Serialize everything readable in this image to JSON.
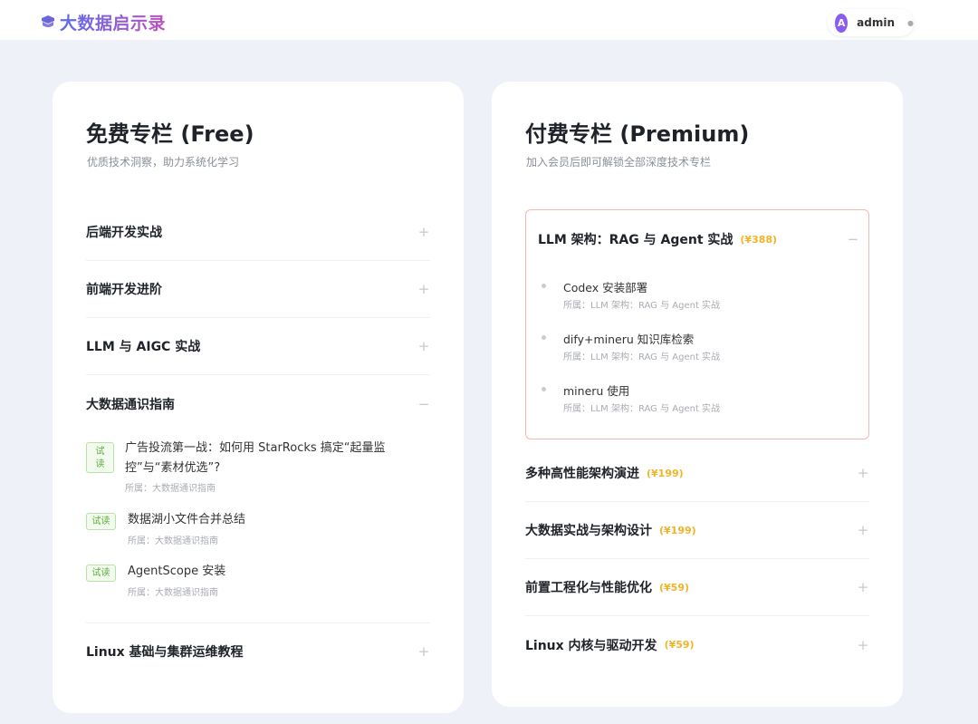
{
  "header": {
    "logo_text": "大数据启示录",
    "user": {
      "avatar_letter": "A",
      "name": "admin"
    }
  },
  "free": {
    "title": "免费专栏 (Free)",
    "subtitle": "优质技术洞察，助力系统化学习",
    "sections": [
      {
        "label": "后端开发实战",
        "toggle": "+"
      },
      {
        "label": "前端开发进阶",
        "toggle": "+"
      },
      {
        "label": "LLM 与 AIGC 实战",
        "toggle": "+"
      },
      {
        "label": "大数据通识指南",
        "toggle": "−"
      },
      {
        "label": "Linux 基础与集群运维教程",
        "toggle": "+"
      }
    ],
    "articles": [
      {
        "badge": "试读",
        "title": "广告投流第一战：如何用 StarRocks 搞定“起量监控”与“素材优选”?",
        "meta": "所属：大数据通识指南"
      },
      {
        "badge": "试读",
        "title": "数据湖小文件合并总结",
        "meta": "所属：大数据通识指南"
      },
      {
        "badge": "试读",
        "title": "AgentScope 安装",
        "meta": "所属：大数据通识指南"
      }
    ]
  },
  "premium": {
    "title": "付费专栏 (Premium)",
    "subtitle": "加入会员后即可解锁全部深度技术专栏",
    "expanded": {
      "label": "LLM 架构：RAG 与 Agent 实战",
      "price": "(¥388)",
      "toggle": "−",
      "items": [
        {
          "title": "Codex 安装部署",
          "meta": "所属：LLM 架构：RAG 与 Agent 实战"
        },
        {
          "title": "dify+mineru 知识库检索",
          "meta": "所属：LLM 架构：RAG 与 Agent 实战"
        },
        {
          "title": "mineru 使用",
          "meta": "所属：LLM 架构：RAG 与 Agent 实战"
        }
      ]
    },
    "sections": [
      {
        "label": "多种高性能架构演进",
        "price": "(¥199)",
        "toggle": "+"
      },
      {
        "label": "大数据实战与架构设计",
        "price": "(¥199)",
        "toggle": "+"
      },
      {
        "label": "前置工程化与性能优化",
        "price": "(¥59)",
        "toggle": "+"
      },
      {
        "label": "Linux 内核与驱动开发",
        "price": "(¥59)",
        "toggle": "+"
      }
    ]
  },
  "colors": {
    "background": "#eef1f8",
    "accent_purple": "#8a5cf0",
    "price_gold": "#f0b429",
    "trial_green": "#5aae3c",
    "active_border": "#f3b9b1"
  }
}
